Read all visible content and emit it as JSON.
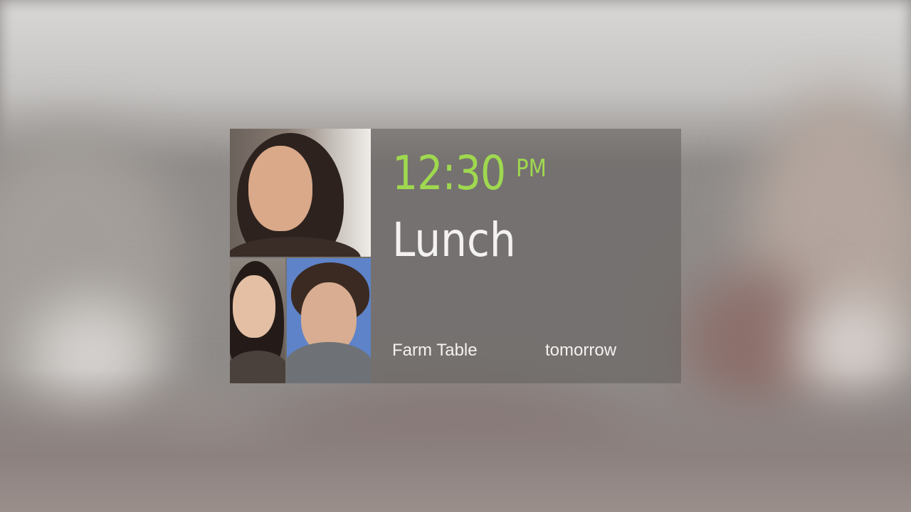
{
  "card": {
    "time": "12:30",
    "period": "PM",
    "title": "Lunch",
    "location": "Farm Table",
    "day": "tomorrow",
    "colors": {
      "accent": "#9fd84f",
      "text": "#f3f2f0"
    }
  },
  "participants": [
    {
      "icon": "avatar-woman-smiling"
    },
    {
      "icon": "avatar-woman"
    },
    {
      "icon": "avatar-man"
    }
  ]
}
